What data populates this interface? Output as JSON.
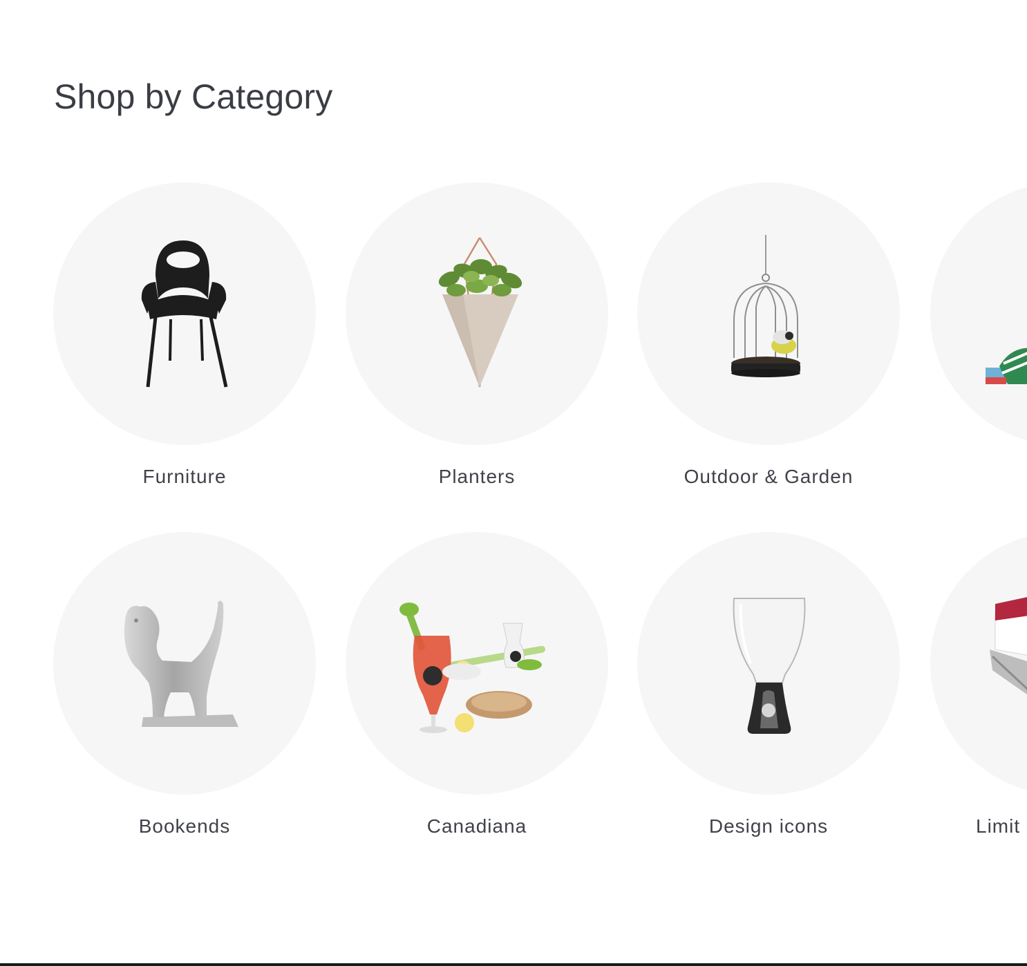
{
  "section": {
    "title": "Shop by Category"
  },
  "categories": [
    {
      "label": "Furniture",
      "icon": "chair-icon"
    },
    {
      "label": "Planters",
      "icon": "planter-icon"
    },
    {
      "label": "Outdoor & Garden",
      "icon": "birdcage-icon"
    },
    {
      "label": "",
      "icon": "textile-icon"
    },
    {
      "label": "Bookends",
      "icon": "dog-bookend-icon"
    },
    {
      "label": "Canadiana",
      "icon": "caesar-glass-icon"
    },
    {
      "label": "Design icons",
      "icon": "wine-glass-icon"
    },
    {
      "label": "Limit",
      "icon": "gift-box-icon"
    }
  ],
  "colors": {
    "title": "#3b3d45",
    "label": "#404249",
    "circle_bg": "#f6f6f6"
  }
}
